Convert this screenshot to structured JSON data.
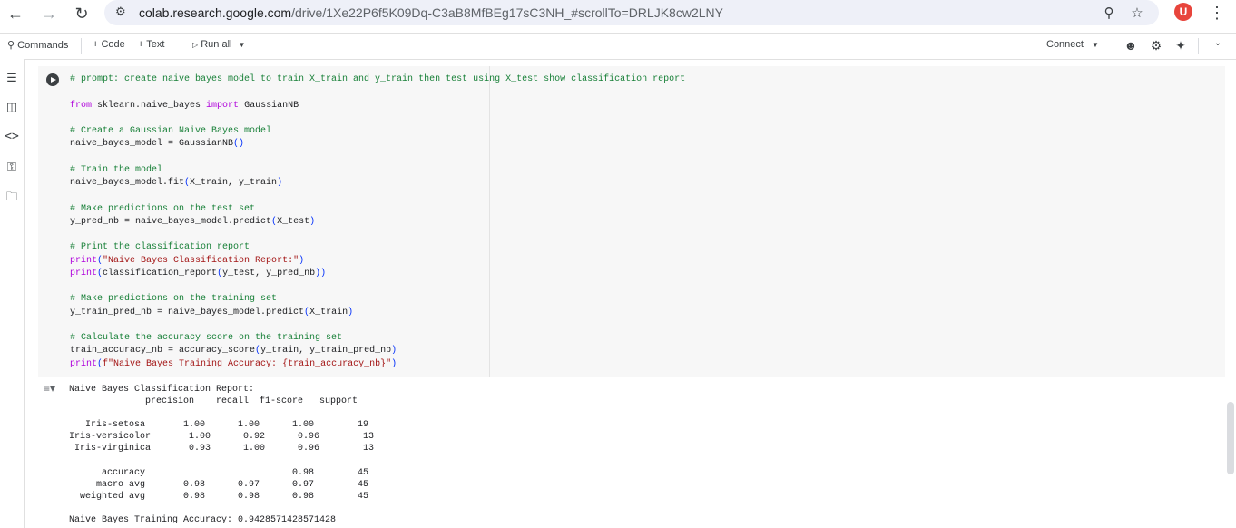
{
  "browser": {
    "url_host": "colab.research.google.com",
    "url_path": "/drive/1Xe22P6f5K09Dq-C3aB8MfBEg17sC3NH_#scrollTo=DRLJK8cw2LNY",
    "avatar_letter": "U"
  },
  "toolbar": {
    "commands_label": "Commands",
    "code_label": "+ Code",
    "text_label": "+ Text",
    "run_all_label": "Run all",
    "connect_label": "Connect"
  },
  "cell": {
    "comment_prompt": "# prompt: create naive bayes model to train X_train and y_train then test using X_test show classification report",
    "kw_from": "from",
    "import_module": " sklearn.naive_bayes ",
    "kw_import": "import",
    "import_name": " GaussianNB",
    "comment_create": "# Create a Gaussian Naive Bayes model",
    "create_line": "naive_bayes_model = GaussianNB",
    "comment_train": "# Train the model",
    "train_line": "naive_bayes_model.fit",
    "train_args": "X_train, y_train",
    "comment_predict": "# Make predictions on the test set",
    "predict_line": "y_pred_nb = naive_bayes_model.predict",
    "predict_args": "X_test",
    "comment_print": "# Print the classification report",
    "print_fn": "print",
    "print1_str": "\"Naive Bayes Classification Report:\"",
    "print2_inner": "classification_report",
    "print2_args": "y_test, y_pred_nb",
    "comment_train_pred": "# Make predictions on the training set",
    "train_pred_line": "y_train_pred_nb = naive_bayes_model.predict",
    "train_pred_args": "X_train",
    "comment_acc": "# Calculate the accuracy score on the training set",
    "acc_line": "train_accuracy_nb = accuracy_score",
    "acc_args": "y_train, y_train_pred_nb",
    "print3_str": "f\"Naive Bayes Training Accuracy: {train_accuracy_nb}\""
  },
  "output": {
    "text": "Naive Bayes Classification Report:\n              precision    recall  f1-score   support\n\n   Iris-setosa       1.00      1.00      1.00        19\nIris-versicolor       1.00      0.92      0.96        13\n Iris-virginica       0.93      1.00      0.96        13\n\n      accuracy                           0.98        45\n     macro avg       0.98      0.97      0.97        45\n  weighted avg       0.98      0.98      0.98        45\n\nNaive Bayes Training Accuracy: 0.9428571428571428"
  }
}
